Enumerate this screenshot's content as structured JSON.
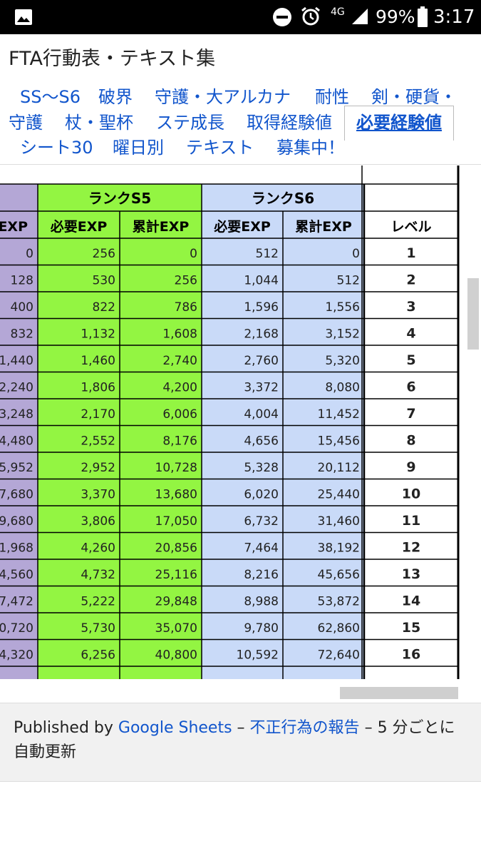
{
  "status_bar": {
    "battery_percent": "99%",
    "time": "3:17",
    "network": "4G",
    "icons": [
      "image-icon",
      "do-not-disturb-icon",
      "alarm-icon",
      "signal-icon",
      "battery-icon"
    ]
  },
  "document": {
    "title": "FTA行動表・テキスト集"
  },
  "tabs": [
    {
      "label": "SS〜S6"
    },
    {
      "label": "破界"
    },
    {
      "label": "守護・大アルカナ"
    },
    {
      "label": "耐性"
    },
    {
      "label": "剣・硬貨・"
    },
    {
      "label": "守護"
    },
    {
      "label": "杖・聖杯"
    },
    {
      "label": "ステ成長"
    },
    {
      "label": "取得経験値"
    },
    {
      "label": "必要経験値",
      "active": true
    },
    {
      "label": "シート30"
    },
    {
      "label": "曜日別"
    },
    {
      "label": "テキスト"
    },
    {
      "label": "募集中！"
    }
  ],
  "table": {
    "group_headers": [
      "ランクS5",
      "ランクS6"
    ],
    "col_headers": [
      "EXP",
      "必要EXP",
      "累計EXP",
      "必要EXP",
      "累計EXP",
      "レベル"
    ],
    "rows": [
      [
        "0",
        "256",
        "0",
        "512",
        "0",
        "1"
      ],
      [
        "128",
        "530",
        "256",
        "1,044",
        "512",
        "2"
      ],
      [
        "400",
        "822",
        "786",
        "1,596",
        "1,556",
        "3"
      ],
      [
        "832",
        "1,132",
        "1,608",
        "2,168",
        "3,152",
        "4"
      ],
      [
        "1,440",
        "1,460",
        "2,740",
        "2,760",
        "5,320",
        "5"
      ],
      [
        "2,240",
        "1,806",
        "4,200",
        "3,372",
        "8,080",
        "6"
      ],
      [
        "3,248",
        "2,170",
        "6,006",
        "4,004",
        "11,452",
        "7"
      ],
      [
        "4,480",
        "2,552",
        "8,176",
        "4,656",
        "15,456",
        "8"
      ],
      [
        "5,952",
        "2,952",
        "10,728",
        "5,328",
        "20,112",
        "9"
      ],
      [
        "7,680",
        "3,370",
        "13,680",
        "6,020",
        "25,440",
        "10"
      ],
      [
        "9,680",
        "3,806",
        "17,050",
        "6,732",
        "31,460",
        "11"
      ],
      [
        "1,968",
        "4,260",
        "20,856",
        "7,464",
        "38,192",
        "12"
      ],
      [
        "4,560",
        "4,732",
        "25,116",
        "8,216",
        "45,656",
        "13"
      ],
      [
        "7,472",
        "5,222",
        "29,848",
        "8,988",
        "53,872",
        "14"
      ],
      [
        "0,720",
        "5,730",
        "35,070",
        "9,780",
        "62,860",
        "15"
      ],
      [
        "4,320",
        "6,256",
        "40,800",
        "10,592",
        "72,640",
        "16"
      ]
    ],
    "colors": {
      "purple": "#b4a7d6",
      "green": "#93f542",
      "blue": "#c9daf8"
    }
  },
  "footer": {
    "published_by": "Published by",
    "google_sheets": "Google Sheets",
    "sep1": "–",
    "report_abuse": "不正行為の報告",
    "sep2": "–",
    "update_text": "5 分ごとに自動更新"
  }
}
